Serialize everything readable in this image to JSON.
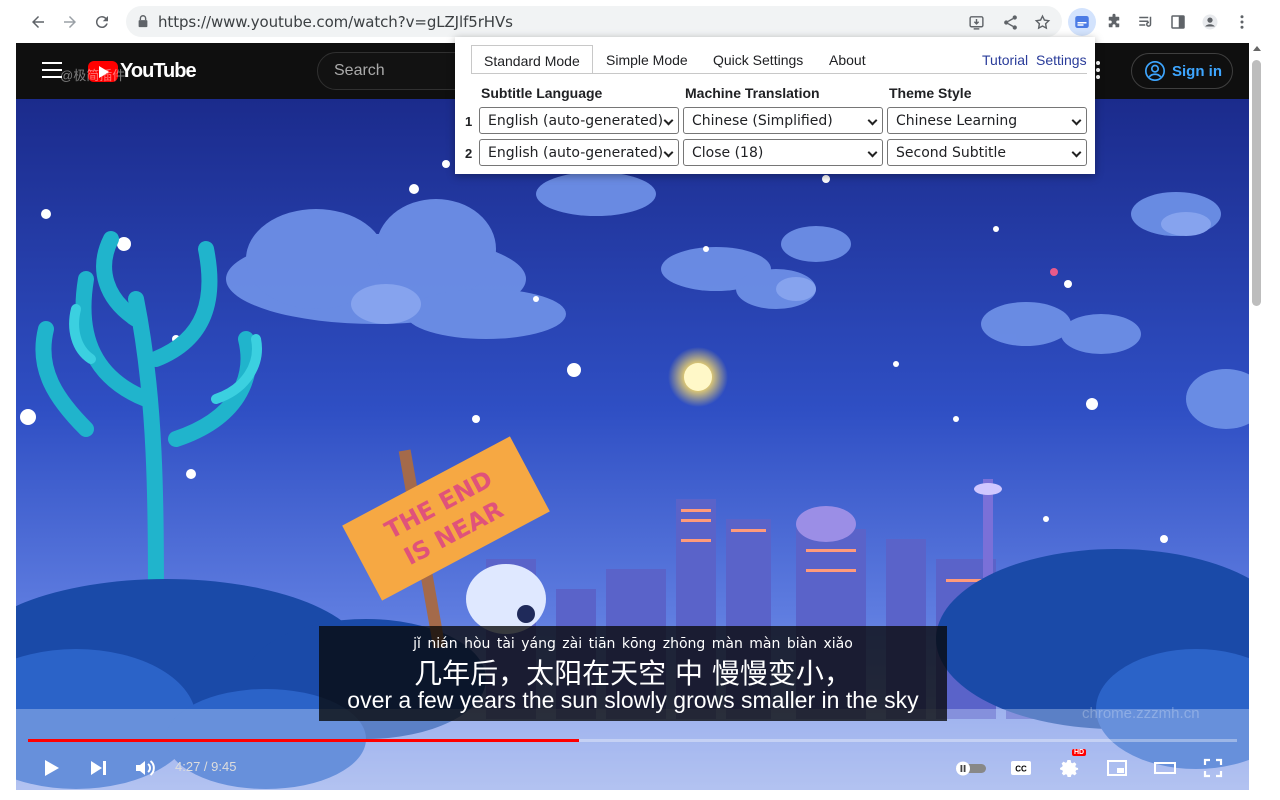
{
  "browser": {
    "url": "https://www.youtube.com/watch?v=gLZJlf5rHVs",
    "icons": [
      "back-icon",
      "forward-icon",
      "reload-icon",
      "lock-icon",
      "install-icon",
      "share-icon",
      "bookmark-star-icon",
      "extension-subtitle-icon",
      "puzzle-icon",
      "reading-list-icon",
      "side-panel-icon",
      "profile-icon",
      "menu-icon"
    ]
  },
  "youtube": {
    "logo_text": "YouTube",
    "watermark_top": "@极简插件",
    "search_placeholder": "Search",
    "signin_label": "Sign in"
  },
  "popup": {
    "tabs": [
      {
        "label": "Standard Mode",
        "active": true
      },
      {
        "label": "Simple Mode",
        "active": false
      },
      {
        "label": "Quick Settings",
        "active": false
      },
      {
        "label": "About",
        "active": false
      }
    ],
    "links": {
      "tutorial": "Tutorial",
      "settings": "Settings"
    },
    "columns": [
      "Subtitle Language",
      "Machine Translation",
      "Theme Style"
    ],
    "rows": [
      {
        "num": "1",
        "subtitle_language": "English (auto-generated)",
        "machine_translation": "Chinese (Simplified)",
        "theme_style": "Chinese Learning"
      },
      {
        "num": "2",
        "subtitle_language": "English (auto-generated)",
        "machine_translation": "Close (18)",
        "theme_style": "Second Subtitle"
      }
    ]
  },
  "video": {
    "sign_text_1": "THE END",
    "sign_text_2": "IS NEAR",
    "subtitle_pinyin": "jǐ  nián hòu       tài yáng zài tiān kōng zhōng màn màn biàn xiǎo",
    "subtitle_chinese": "几年后，太阳在天空 中 慢慢变小，",
    "subtitle_english": "over a few years the sun slowly grows smaller in the sky",
    "watermark_bottom": "chrome.zzzmh.cn",
    "time_display": "4:27 / 9:45",
    "progress_fraction": 0.456,
    "hd_badge": "HD"
  },
  "colors": {
    "yt_red": "#ff0000",
    "signin_blue": "#3ea6ff",
    "link_blue": "#2a3c9a"
  }
}
